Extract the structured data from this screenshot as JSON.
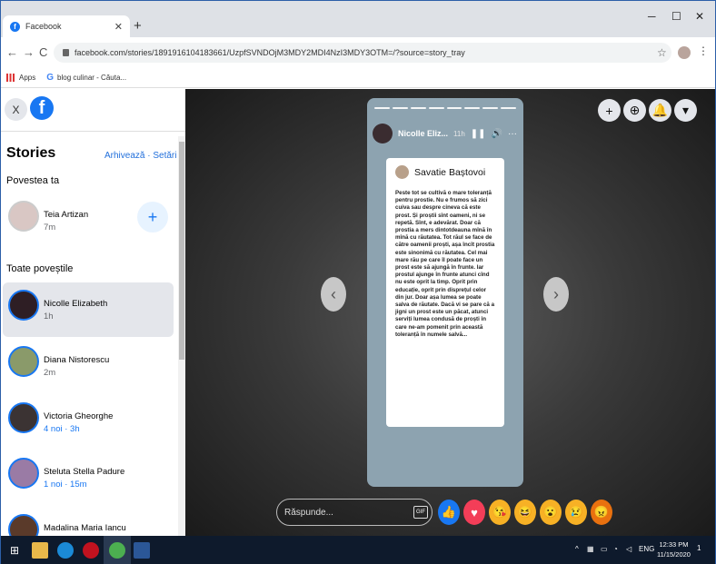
{
  "browser": {
    "tab_title": "Facebook",
    "tab_close": "✕",
    "new_tab": "+",
    "minimize": "─",
    "maximize": "☐",
    "close": "✕",
    "back": "←",
    "forward": "→",
    "reload": "C",
    "url": "facebook.com/stories/1891916104183661/UzpfSVNDOjM3MDY2MDI4NzI3MDY3OTM=/?source=story_tray",
    "star": "☆",
    "menu": "⋮"
  },
  "bookmarks": [
    {
      "label": "Apps"
    },
    {
      "label": "blog culinar - Căuta..."
    }
  ],
  "sidebar": {
    "close": "X",
    "logo": "f",
    "title": "Stories",
    "links": "Arhivează · Setări",
    "your_story_heading": "Povestea ta",
    "your_story": {
      "name": "Teia Artizan",
      "time": "7m"
    },
    "add_story": "+",
    "all_stories_heading": "Toate poveștile",
    "stories": [
      {
        "name": "Nicolle Elizabeth",
        "time": "1h"
      },
      {
        "name": "Diana Nistorescu",
        "time": "2m"
      },
      {
        "name": "Victoria Gheorghe",
        "time": "4 noi · 3h"
      },
      {
        "name": "Steluta Stella Padure",
        "time": "1 noi · 15m"
      },
      {
        "name": "Madalina Maria Iancu",
        "time": ""
      }
    ]
  },
  "viewer": {
    "top_buttons": [
      "+",
      "⊕",
      "🔔",
      "▾"
    ],
    "prev": "‹",
    "next": "›",
    "story_name": "Nicolle Eliz...",
    "story_time": "11h",
    "pause": "❚❚",
    "sound": "🔊",
    "more": "···",
    "post_author": "Savatie Baștovoi",
    "post_text": "Peste tot se cultivă o mare toleranță pentru prostie. Nu e frumos să zici cuiva sau despre cineva că este prost. Și proștii sînt oameni, ni se repetă. Sînt, e adevărat. Doar că prostia a mers dintotdeauna mînă în mînă cu răutatea. Tot răul se face de către oamenii proști, așa încît prostia este sinonimă cu răutatea. Cel mai mare rău pe care îl poate face un prost este să ajungă în frunte. Iar prostul ajunge în frunte atunci cînd nu este oprit la timp. Oprit prin educație, oprit prin disprețul celor din jur. Doar așa lumea se poate salva de răutate. Dacă vi se pare că a jigni un prost este un păcat, atunci serviți lumea condusă de proști în care ne-am pomenit prin această toleranță în numele salvă...",
    "reply_placeholder": "Răspunde...",
    "gif": "GIF",
    "reactions": [
      {
        "name": "like",
        "glyph": "👍",
        "color": "#1877f2"
      },
      {
        "name": "love",
        "glyph": "♥",
        "color": "#f33e58"
      },
      {
        "name": "care",
        "glyph": "😘",
        "color": "#f7b125"
      },
      {
        "name": "haha",
        "glyph": "😆",
        "color": "#f7b125"
      },
      {
        "name": "wow",
        "glyph": "😮",
        "color": "#f7b125"
      },
      {
        "name": "sad",
        "glyph": "😢",
        "color": "#f7b125"
      },
      {
        "name": "angry",
        "glyph": "😠",
        "color": "#e9710f"
      }
    ]
  },
  "taskbar": {
    "start": "⊞",
    "lang": "ENG",
    "time": "12:33 PM",
    "date": "11/15/2020",
    "notifications": "1"
  }
}
